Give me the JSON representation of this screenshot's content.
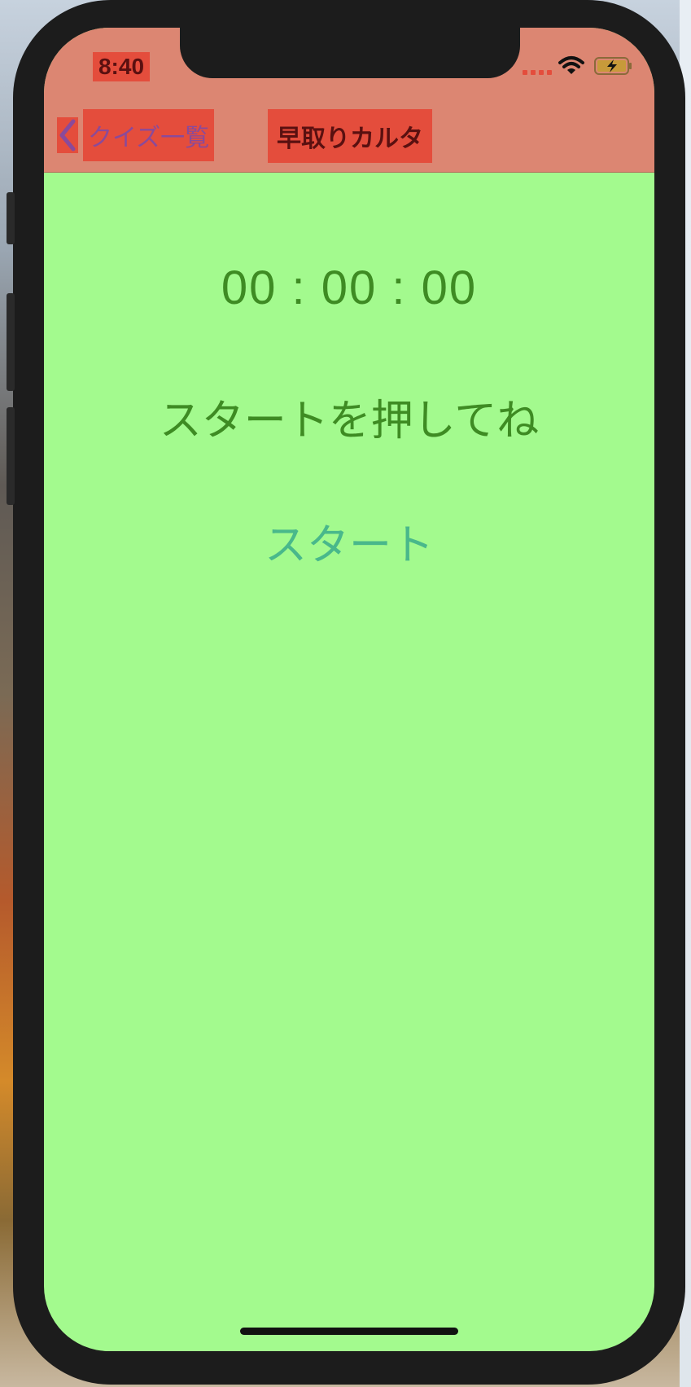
{
  "status_bar": {
    "time": "8:40",
    "icons": [
      "signal-dots-icon",
      "wifi-icon",
      "battery-charging-icon"
    ]
  },
  "nav": {
    "back_label": "クイズ一覧",
    "title": "早取りカルタ"
  },
  "main": {
    "timer": "00 : 00 : 00",
    "message": "スタートを押してね",
    "start_button": "スタート"
  },
  "colors": {
    "screen_background": "#a3fa8e",
    "header_background": "#dc8672",
    "highlight": "#e44d3c",
    "text_green": "#3e8b23",
    "button_teal": "#49b88b",
    "back_label_purple": "#8a4a9a"
  }
}
